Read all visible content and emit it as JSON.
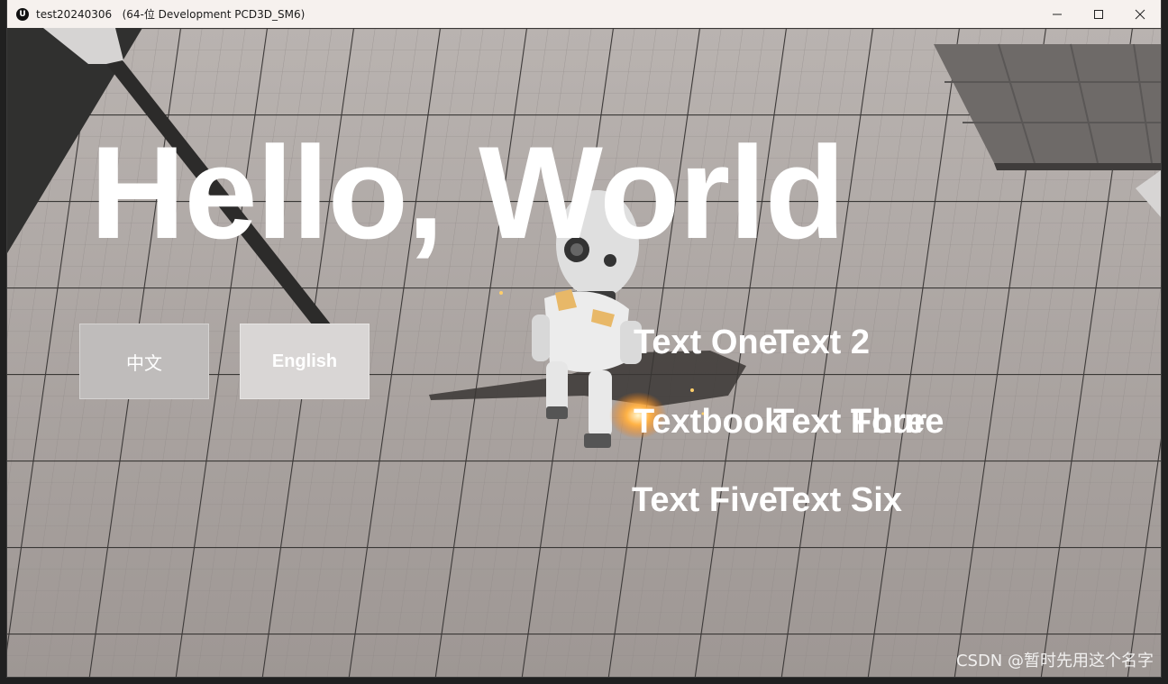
{
  "window": {
    "title": "test20240306   (64-位 Development PCD3D_SM6)",
    "app_icon": "unreal-engine-logo-icon",
    "controls": [
      "minimize-icon",
      "maximize-icon",
      "close-icon"
    ]
  },
  "hud": {
    "headline": "Hello, World",
    "buttons": {
      "chinese": "中文",
      "english": "English"
    },
    "texts": {
      "one": "Text One",
      "two": "Text 2",
      "three": "Textbook",
      "three_overlay": "Text Three",
      "four": "Text Four",
      "five": "Text Five",
      "six": "Text Six"
    }
  },
  "watermark": "CSDN @暂时先用这个名字",
  "colors": {
    "floor": "#a9a29f",
    "grid_line": "#3c3a39",
    "hud_text": "#ffffff",
    "button_chinese": "#bfbcbb",
    "button_english": "#d9d6d5"
  }
}
